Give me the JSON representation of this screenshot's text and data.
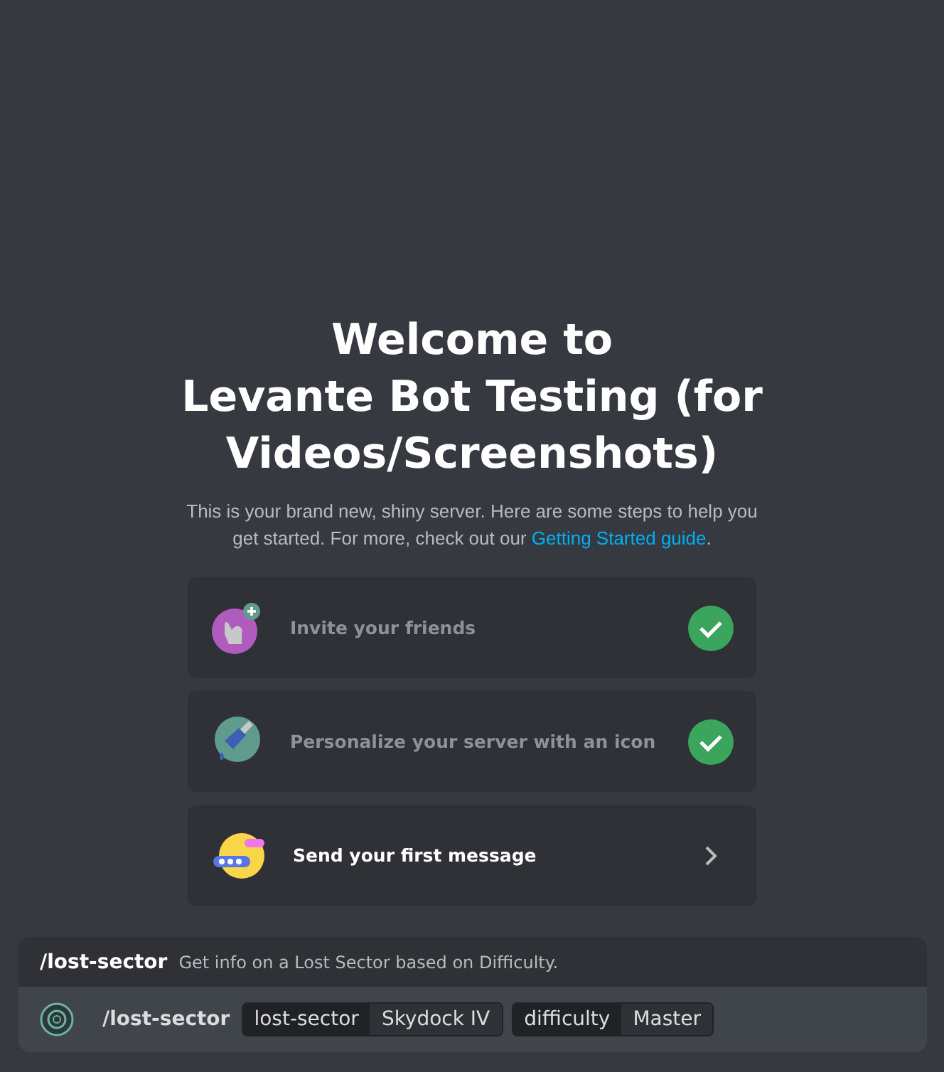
{
  "welcome": {
    "title_lines": [
      "Welcome to",
      "Levante Bot Testing (for",
      "Videos/Screenshots)"
    ],
    "description": "This is your brand new, shiny server. Here are some steps to help you get started. For more, check out our ",
    "link": "Getting Started guide",
    "description_end": "."
  },
  "tasks": [
    {
      "kind": "invite",
      "label": "Invite your friends",
      "completed": true
    },
    {
      "kind": "personalize",
      "label": "Personalize your server with an icon",
      "completed": true
    },
    {
      "kind": "message",
      "label": "Send your first message",
      "completed": false
    }
  ],
  "command": {
    "name": "/lost-sector",
    "description": "Get info on a Lost Sector based on Difficulty.",
    "input_command": "/lost-sector",
    "options": [
      {
        "name": "lost-sector",
        "value": "Skydock IV"
      },
      {
        "name": "difficulty",
        "value": "Master"
      }
    ]
  }
}
